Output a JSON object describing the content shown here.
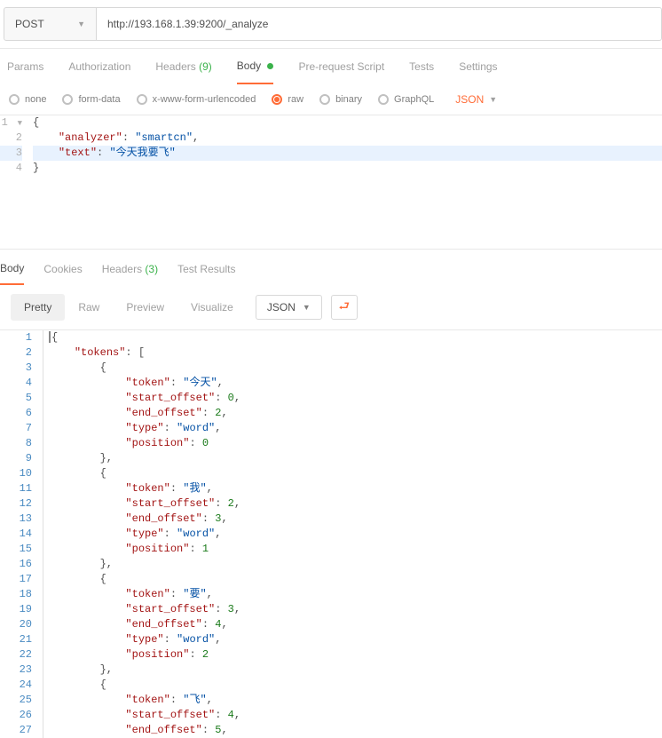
{
  "request": {
    "method": "POST",
    "url": "http://193.168.1.39:9200/_analyze"
  },
  "tabs": {
    "params": "Params",
    "authorization": "Authorization",
    "headers": "Headers",
    "headers_count": "(9)",
    "body": "Body",
    "prerequest": "Pre-request Script",
    "tests": "Tests",
    "settings": "Settings"
  },
  "body_types": {
    "none": "none",
    "formdata": "form-data",
    "urlencoded": "x-www-form-urlencoded",
    "raw": "raw",
    "binary": "binary",
    "graphql": "GraphQL",
    "format": "JSON"
  },
  "request_body": {
    "lines": [
      "1",
      "2",
      "3",
      "4"
    ],
    "l1": "{",
    "l2_k": "\"analyzer\"",
    "l2_c": ": ",
    "l2_v": "\"smartcn\"",
    "l2_e": ",",
    "l3_k": "\"text\"",
    "l3_c": ": ",
    "l3_v": "\"今天我要飞\"",
    "l4": "}"
  },
  "response_tabs": {
    "body": "Body",
    "cookies": "Cookies",
    "headers": "Headers",
    "headers_count": "(3)",
    "testresults": "Test Results"
  },
  "response_tools": {
    "pretty": "Pretty",
    "raw": "Raw",
    "preview": "Preview",
    "visualize": "Visualize",
    "format": "JSON"
  },
  "chart_data": {
    "type": "table",
    "title": "tokens",
    "series": [
      {
        "token": "今天",
        "start_offset": 0,
        "end_offset": 2,
        "type": "word",
        "position": 0
      },
      {
        "token": "我",
        "start_offset": 2,
        "end_offset": 3,
        "type": "word",
        "position": 1
      },
      {
        "token": "要",
        "start_offset": 3,
        "end_offset": 4,
        "type": "word",
        "position": 2
      },
      {
        "token": "飞",
        "start_offset": 4,
        "end_offset": 5
      }
    ]
  },
  "resp": {
    "open_brace": "{",
    "tokens_key": "\"tokens\"",
    "colon_sp": ": ",
    "open_bracket": "[",
    "obj_open": "{",
    "obj_close_c": "},",
    "obj_close": "}",
    "k_token": "\"token\"",
    "k_so": "\"start_offset\"",
    "k_eo": "\"end_offset\"",
    "k_type": "\"type\"",
    "k_pos": "\"position\"",
    "comma": ",",
    "t1_v": "\"今天\"",
    "t1_so": "0",
    "t1_eo": "2",
    "t1_ty": "\"word\"",
    "t1_po": "0",
    "t2_v": "\"我\"",
    "t2_so": "2",
    "t2_eo": "3",
    "t2_ty": "\"word\"",
    "t2_po": "1",
    "t3_v": "\"要\"",
    "t3_so": "3",
    "t3_eo": "4",
    "t3_ty": "\"word\"",
    "t3_po": "2",
    "t4_v": "\"飞\"",
    "t4_so": "4",
    "t4_eo": "5"
  },
  "resp_lines": [
    "1",
    "2",
    "3",
    "4",
    "5",
    "6",
    "7",
    "8",
    "9",
    "10",
    "11",
    "12",
    "13",
    "14",
    "15",
    "16",
    "17",
    "18",
    "19",
    "20",
    "21",
    "22",
    "23",
    "24",
    "25",
    "26",
    "27"
  ]
}
